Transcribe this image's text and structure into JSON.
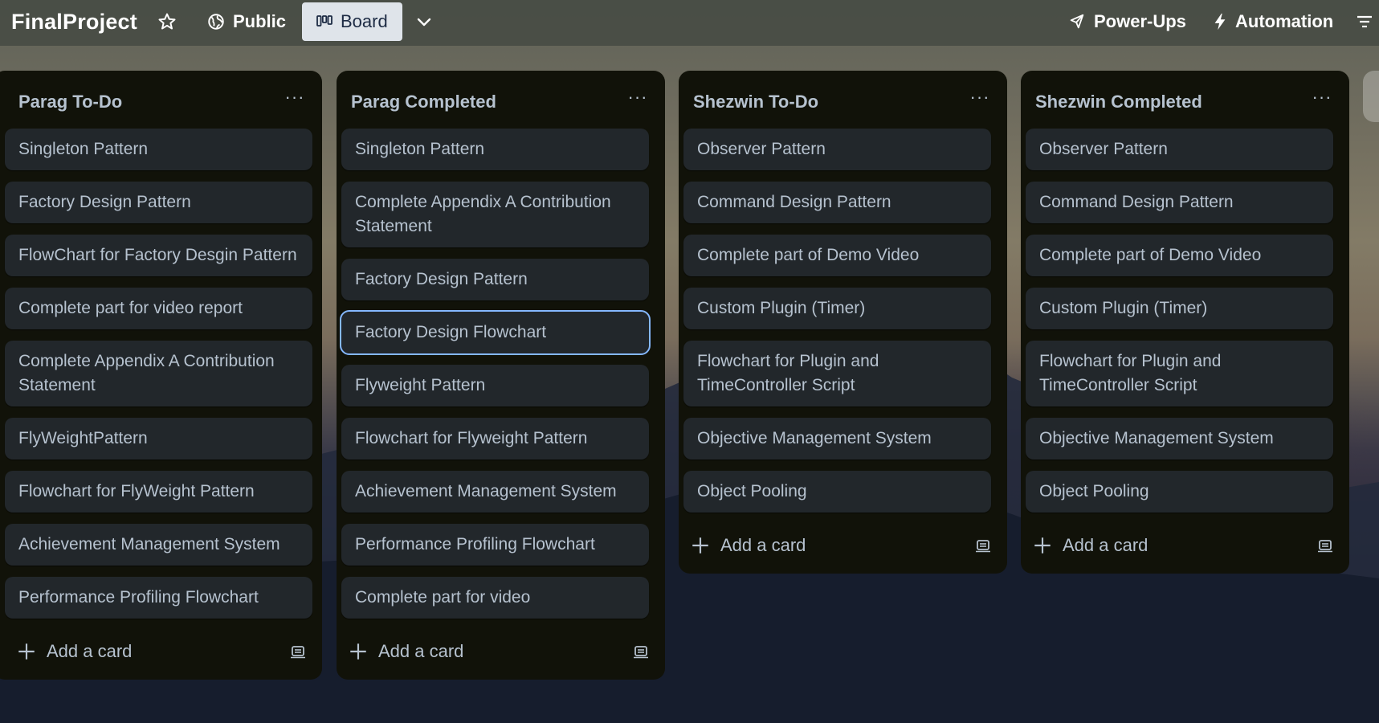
{
  "header": {
    "board_title": "FinalProject",
    "visibility_label": "Public",
    "view_label": "Board",
    "powerups_label": "Power-Ups",
    "automation_label": "Automation"
  },
  "lists": [
    {
      "title": "Parag To-Do",
      "cards": [
        "Singleton Pattern",
        "Factory Design Pattern",
        "FlowChart for Factory Desgin Pattern",
        "Complete part for video report",
        "Complete Appendix A Contribution Statement",
        "FlyWeightPattern",
        "Flowchart for FlyWeight Pattern",
        "Achievement Management System",
        "Performance Profiling Flowchart"
      ],
      "add_card_label": "Add a card"
    },
    {
      "title": "Parag Completed",
      "cards": [
        "Singleton Pattern",
        "Complete Appendix A Contribution Statement",
        "Factory Design Pattern",
        "Factory Design Flowchart",
        "Flyweight Pattern",
        "Flowchart for Flyweight Pattern",
        "Achievement Management System",
        "Performance Profiling Flowchart",
        "Complete part for video"
      ],
      "add_card_label": "Add a card"
    },
    {
      "title": "Shezwin To-Do",
      "cards": [
        "Observer Pattern",
        "Command Design Pattern",
        "Complete part of Demo Video",
        "Custom Plugin (Timer)",
        "Flowchart for Plugin and TimeController Script",
        "Objective Management System",
        "Object Pooling"
      ],
      "add_card_label": "Add a card"
    },
    {
      "title": "Shezwin Completed",
      "cards": [
        "Observer Pattern",
        "Command Design Pattern",
        "Complete part of Demo Video",
        "Custom Plugin (Timer)",
        "Flowchart for Plugin and TimeController Script",
        "Objective Management System",
        "Object Pooling"
      ],
      "add_card_label": "Add a card"
    }
  ],
  "selected_card": "Factory Design Flowchart",
  "colors": {
    "list_bg": "#111209",
    "card_bg": "#22272b",
    "card_text": "#b6c2cf",
    "selected_outline": "#85b8ff",
    "board_button_bg": "#dfe4ea"
  }
}
